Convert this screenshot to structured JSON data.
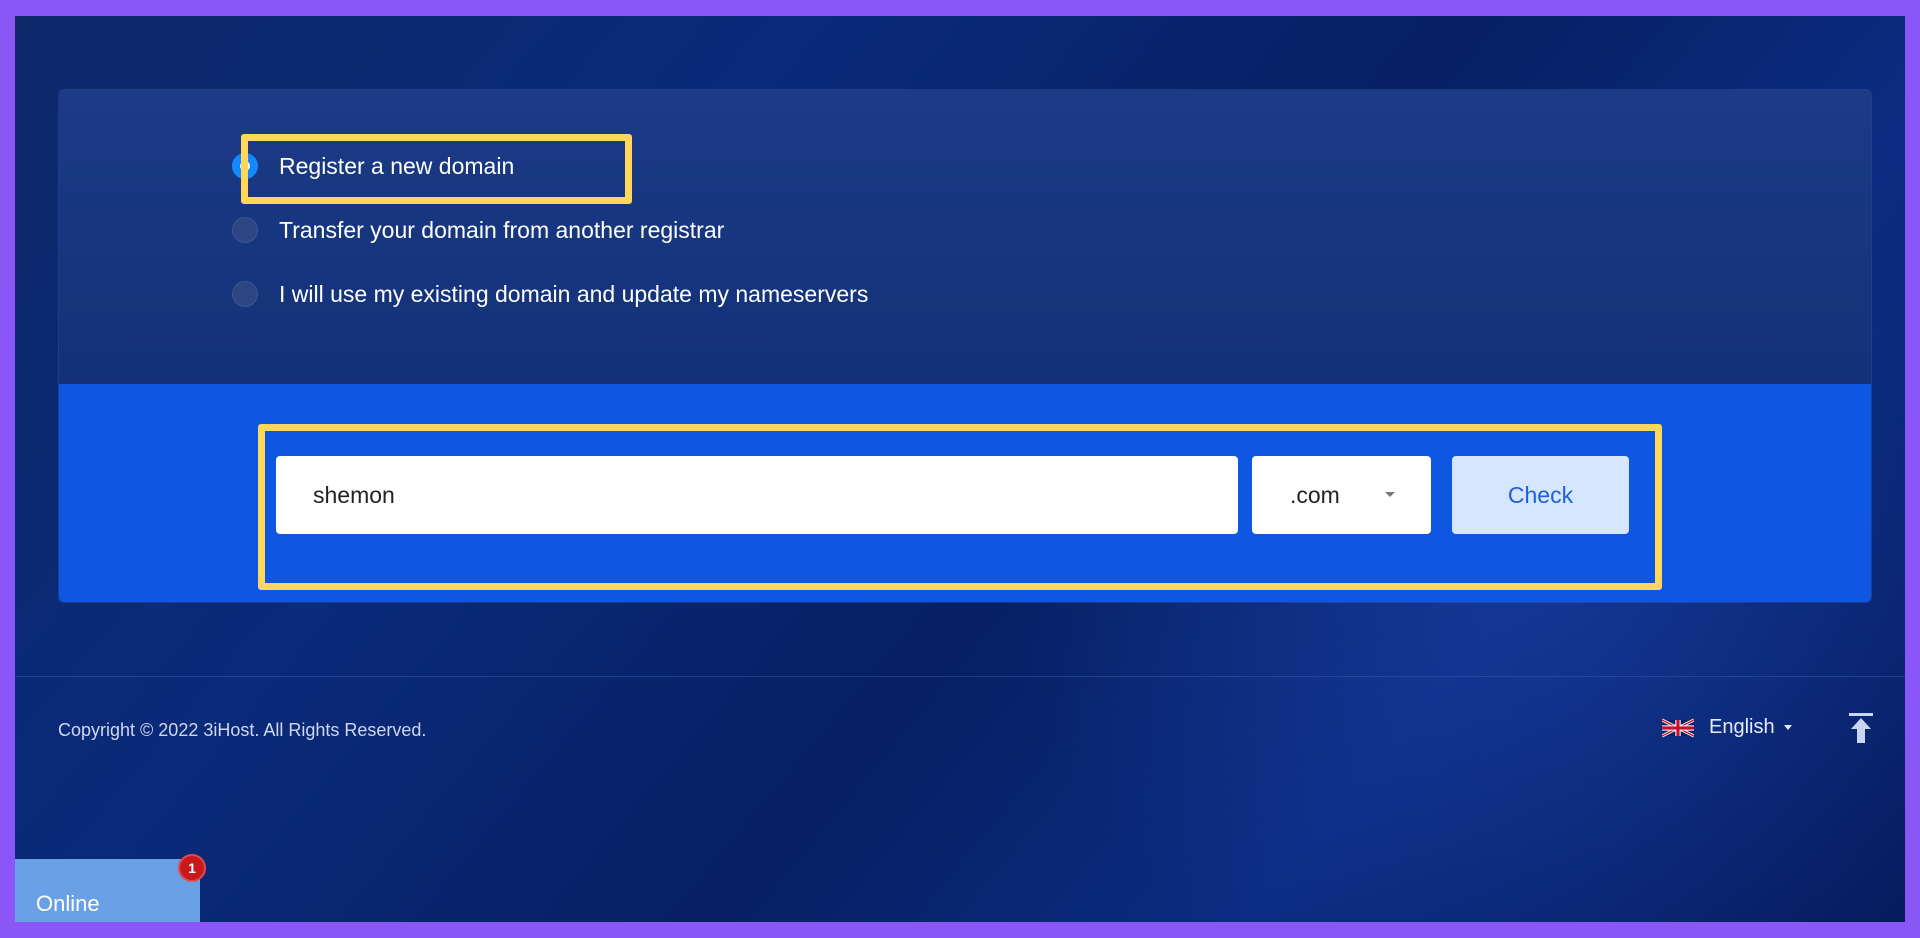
{
  "domain_options": [
    {
      "label": "Register a new domain",
      "checked": true
    },
    {
      "label": "Transfer your domain from another registrar",
      "checked": false
    },
    {
      "label": "I will use my existing domain and update my nameservers",
      "checked": false
    }
  ],
  "search": {
    "value": "shemon",
    "tld": ".com",
    "check_label": "Check"
  },
  "footer": {
    "copyright": "Copyright © 2022 3iHost. All Rights Reserved.",
    "language": "English"
  },
  "chat": {
    "label": "Online",
    "badge_count": "1"
  },
  "colors": {
    "accent": "#1488ff",
    "highlight": "#ffd75b",
    "search_band": "#0d57e3",
    "border": "#8a56f5"
  },
  "icons": {
    "flag": "uk-flag-icon",
    "back_to_top": "arrow-up-to-line-icon"
  }
}
